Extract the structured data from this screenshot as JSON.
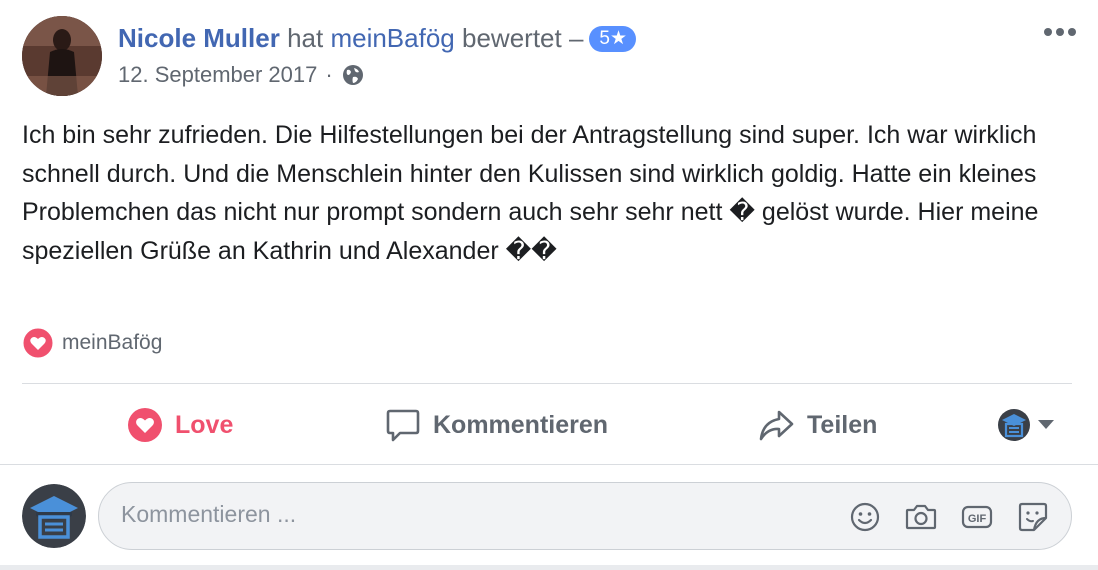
{
  "post": {
    "author": "Nicole Muller",
    "verb": "hat",
    "page_name": "meinBafög",
    "action_text": "bewertet –",
    "rating": "5★",
    "date": "12. September 2017",
    "separator": "·",
    "body": "Ich bin sehr zufrieden. Die Hilfestellungen bei der Antragstellung sind super. Ich war wirklich schnell durch. Und die Menschlein hinter den Kulissen sind wirklich goldig. Hatte ein kleines Problemchen das nicht nur prompt sondern auch sehr sehr nett � gelöst wurde. Hier meine speziellen Grüße an Kathrin und Alexander ��"
  },
  "reactions": {
    "name": "meinBafög",
    "icon": "heart-icon"
  },
  "actions": {
    "love_label": "Love",
    "comment_label": "Kommentieren",
    "share_label": "Teilen"
  },
  "composer": {
    "placeholder": "Kommentieren ...",
    "value": ""
  },
  "colors": {
    "link": "#4267b2",
    "love": "#f0506e",
    "badge": "#5890ff",
    "muted": "#606770"
  }
}
